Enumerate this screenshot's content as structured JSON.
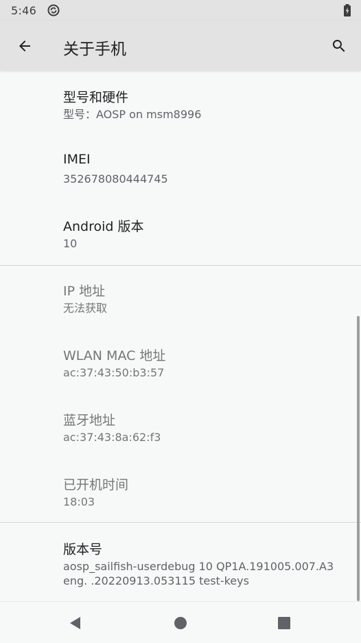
{
  "status_bar": {
    "time": "5:46",
    "sync_icon": "sync-icon",
    "battery_icon": "battery-icon"
  },
  "app_bar": {
    "title": "关于手机",
    "back_icon": "arrow-back-icon",
    "search_icon": "search-icon"
  },
  "items": [
    {
      "title": "型号和硬件",
      "summary": "型号：AOSP on msm8996"
    },
    {
      "title": "IMEI",
      "summary": "352678080444745"
    },
    {
      "title": "Android 版本",
      "summary": "10"
    },
    {
      "title": "IP 地址",
      "summary": "无法获取"
    },
    {
      "title": "WLAN MAC 地址",
      "summary": "ac:37:43:50:b3:57"
    },
    {
      "title": "蓝牙地址",
      "summary": "ac:37:43:8a:62:f3"
    },
    {
      "title": "已开机时间",
      "summary": "18:03"
    },
    {
      "title": "版本号",
      "summary_line1": "aosp_sailfish-userdebug 10 QP1A.191005.007.A3",
      "summary_line2": "eng.  .20220913.053115 test-keys"
    }
  ],
  "nav_bar": {
    "back_icon": "nav-back-triangle-icon",
    "home_icon": "nav-home-circle-icon",
    "recents_icon": "nav-recents-square-icon"
  },
  "colors": {
    "background": "#f7f9f8",
    "app_bar": "#e2e3e2",
    "primary_text": "#202124",
    "secondary_text": "#5f6368",
    "disabled_text": "#757575"
  }
}
